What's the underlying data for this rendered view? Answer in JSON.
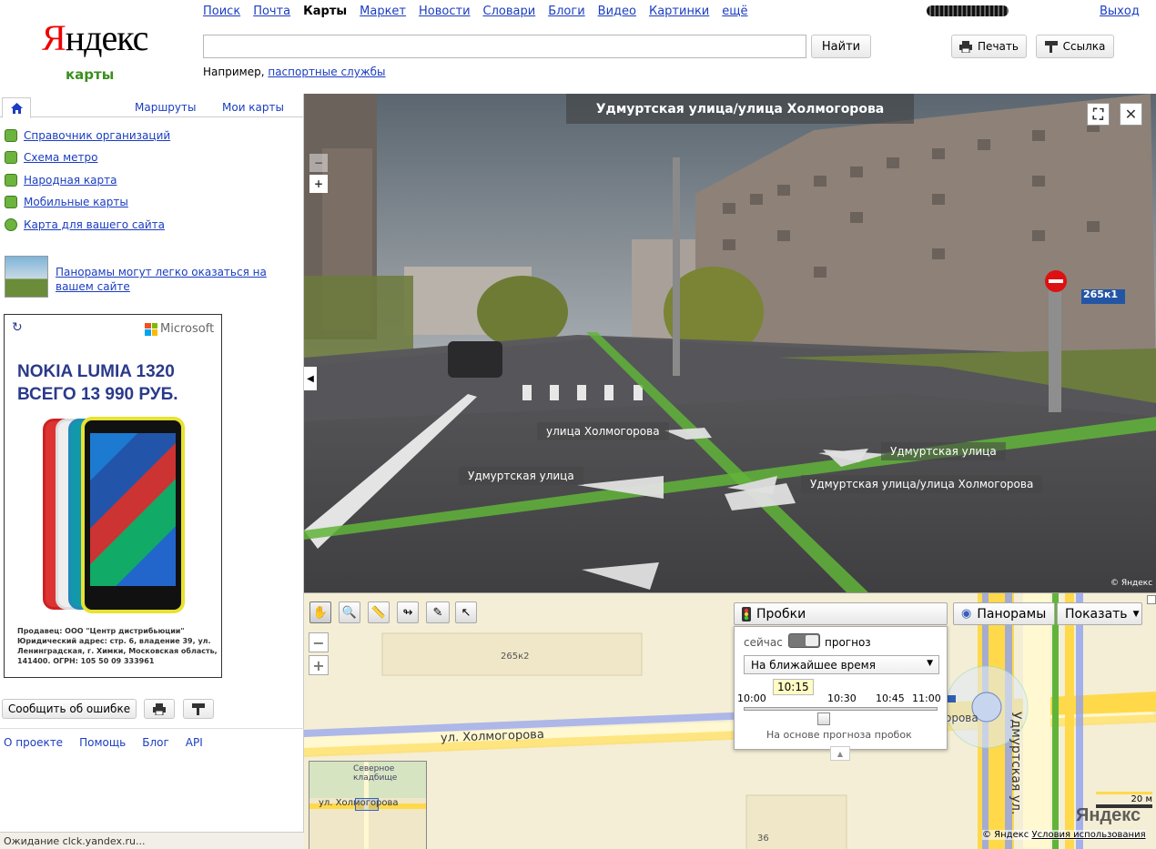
{
  "header": {
    "logo": {
      "first": "Я",
      "rest": "ндекс",
      "sub": "карты"
    },
    "services": [
      {
        "label": "Поиск",
        "active": false
      },
      {
        "label": "Почта",
        "active": false
      },
      {
        "label": "Карты",
        "active": true
      },
      {
        "label": "Маркет",
        "active": false
      },
      {
        "label": "Новости",
        "active": false
      },
      {
        "label": "Словари",
        "active": false
      },
      {
        "label": "Блоги",
        "active": false
      },
      {
        "label": "Видео",
        "active": false
      },
      {
        "label": "Картинки",
        "active": false
      },
      {
        "label": "ещё",
        "active": false
      }
    ],
    "exit_label": "Выход",
    "search": {
      "value": "",
      "button": "Найти"
    },
    "hint_prefix": "Например,",
    "hint_link": "паспортные службы",
    "print_label": "Печать",
    "link_label": "Ссылка"
  },
  "sidebar": {
    "tabs": {
      "routes": "Маршруты",
      "my_maps": "Мои карты"
    },
    "items": [
      {
        "label": "Справочник организаций"
      },
      {
        "label": "Схема метро"
      },
      {
        "label": "Народная карта"
      },
      {
        "label": "Мобильные карты"
      },
      {
        "label": "Карта для вашего сайта"
      }
    ],
    "panorama_promo": "Панорамы могут легко оказаться на вашем сайте",
    "ad": {
      "brand": "Microsoft",
      "title_line1": "NOKIA LUMIA 1320",
      "title_line2": "ВСЕГО 13 990 РУБ.",
      "legal": "Продавец: ООО \"Центр дистрибьюции\" Юридический адрес: стр. 6, владение 39, ул. Ленинградская, г. Химки, Московская область, 141400. ОГРН: 105 50 09 333961"
    },
    "report_error": "Сообщить об ошибке",
    "footer": [
      "О проекте",
      "Помощь",
      "Блог",
      "API"
    ],
    "status": "Ожидание clck.yandex.ru..."
  },
  "panorama": {
    "title": "Удмуртская улица/улица Холмогорова",
    "labels": [
      {
        "text": "улица Холмогорова"
      },
      {
        "text": "Удмуртская улица"
      },
      {
        "text": "Удмуртская улица"
      },
      {
        "text": "Удмуртская улица/улица Холмогорова"
      }
    ],
    "house_sign": "265к1",
    "copyright": "© Яндекс"
  },
  "map": {
    "traffic": {
      "title": "Пробки",
      "now": "сейчас",
      "forecast": "прогноз",
      "select_value": "На ближайшее время",
      "times": [
        "10:00",
        "10:30",
        "10:45",
        "11:00"
      ],
      "current_time": "10:15",
      "slider_fraction": 0.25,
      "note": "На основе прогноза пробок"
    },
    "panoramas_btn": "Панорамы",
    "show_btn": "Показать",
    "street_main": "ул. Холмогорова",
    "street_vertical": "Удмуртская ул.",
    "building_265k2": "265к2",
    "building_36": "36",
    "minimap": {
      "cemetery": "Северное кладбище",
      "street": "ул. Холмогорова"
    },
    "scale": "20 м",
    "logo": "Яндекс",
    "copyright": "© Яндекс",
    "terms": "Условия использования",
    "partial_label": "орова"
  },
  "colors": {
    "link": "#1a3dc1",
    "logo_red": "#e00000",
    "logo_green": "#3b8e1e",
    "road_yellow": "#ffd94a",
    "road_blue": "#8fa0f0"
  }
}
